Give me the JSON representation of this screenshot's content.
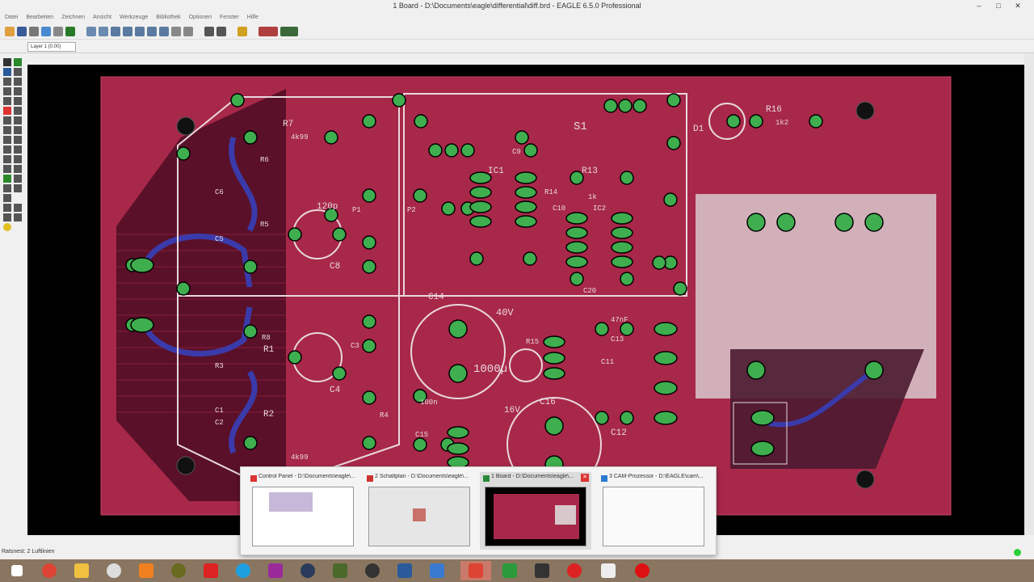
{
  "window": {
    "title": "1 Board - D:\\Documents\\eagle\\differential\\diff.brd - EAGLE 6.5.0 Professional",
    "minimize": "–",
    "maximize": "□",
    "close": "✕"
  },
  "menu": [
    "Datei",
    "Bearbeiten",
    "Zeichnen",
    "Ansicht",
    "Werkzeuge",
    "Bibliothek",
    "Optionen",
    "Fenster",
    "Hilfe"
  ],
  "param_bar": {
    "layer_value": "Layer 1 (0.00)"
  },
  "board": {
    "labels": [
      {
        "text": "R7"
      },
      {
        "text": "4k99"
      },
      {
        "text": "R6"
      },
      {
        "text": "R5"
      },
      {
        "text": "C6"
      },
      {
        "text": "C5"
      },
      {
        "text": "R8"
      },
      {
        "text": "R1"
      },
      {
        "text": "R2"
      },
      {
        "text": "R3"
      },
      {
        "text": "C1"
      },
      {
        "text": "C2"
      },
      {
        "text": "120p"
      },
      {
        "text": "C8"
      },
      {
        "text": "C4"
      },
      {
        "text": "C3"
      },
      {
        "text": "P1"
      },
      {
        "text": "P2"
      },
      {
        "text": "IC1"
      },
      {
        "text": "IC2"
      },
      {
        "text": "R13"
      },
      {
        "text": "R14"
      },
      {
        "text": "1k"
      },
      {
        "text": "C9"
      },
      {
        "text": "C10"
      },
      {
        "text": "C11"
      },
      {
        "text": "C12"
      },
      {
        "text": "C13"
      },
      {
        "text": "C14"
      },
      {
        "text": "C15"
      },
      {
        "text": "C16"
      },
      {
        "text": "R15"
      },
      {
        "text": "R16"
      },
      {
        "text": "1k2"
      },
      {
        "text": "D1"
      },
      {
        "text": "S1"
      },
      {
        "text": "1000µ"
      },
      {
        "text": "40V"
      },
      {
        "text": "16V"
      },
      {
        "text": "100n"
      },
      {
        "text": "47nF"
      },
      {
        "text": "R4"
      },
      {
        "text": "C20"
      },
      {
        "text": "4k99"
      }
    ]
  },
  "status": {
    "text": "Ratsnest: 2 Luftlinien"
  },
  "task_switcher": [
    {
      "label": "Control Panel - D:\\Documents\\eagle\\...",
      "active": false,
      "icon_color": "#d33"
    },
    {
      "label": "2 Schaltplan - D:\\Documents\\eagle\\...",
      "active": false,
      "icon_color": "#c33"
    },
    {
      "label": "1 Board - D:\\Documents\\eagle\\...",
      "active": true,
      "icon_color": "#2a8a3a"
    },
    {
      "label": "3 CAM-Prozessor - D:\\EAGLE\\cam\\...",
      "active": false,
      "icon_color": "#2a7ad0"
    }
  ],
  "taskbar": {
    "items": [
      {
        "icon": "windows-start-icon",
        "color": "#ffffff"
      },
      {
        "icon": "chrome-icon",
        "color": "#dd4433"
      },
      {
        "icon": "folder-icon",
        "color": "#f0c040"
      },
      {
        "icon": "alien-icon",
        "color": "#dddddd"
      },
      {
        "icon": "vlc-icon",
        "color": "#f08020"
      },
      {
        "icon": "gimp-icon",
        "color": "#6a6a20"
      },
      {
        "icon": "spider-icon",
        "color": "#dd2222"
      },
      {
        "icon": "skype-icon",
        "color": "#1ea0e0"
      },
      {
        "icon": "winrar-icon",
        "color": "#9a2a9a"
      },
      {
        "icon": "steam-icon",
        "color": "#2a3a5a"
      },
      {
        "icon": "photo-icon",
        "color": "#4a6a2a"
      },
      {
        "icon": "moon-icon",
        "color": "#333333"
      },
      {
        "icon": "display-icon",
        "color": "#2a5a9a"
      },
      {
        "icon": "network-icon",
        "color": "#3a7ad0"
      },
      {
        "icon": "eagle-red-icon",
        "color": "#dd4433"
      },
      {
        "icon": "eagle-green-icon",
        "color": "#2a9a3a"
      },
      {
        "icon": "bug-icon",
        "color": "#333333"
      },
      {
        "icon": "bug-red-icon",
        "color": "#dd2222"
      },
      {
        "icon": "f-icon",
        "color": "#eeeeee"
      },
      {
        "icon": "record-icon",
        "color": "#dd1111"
      }
    ]
  }
}
